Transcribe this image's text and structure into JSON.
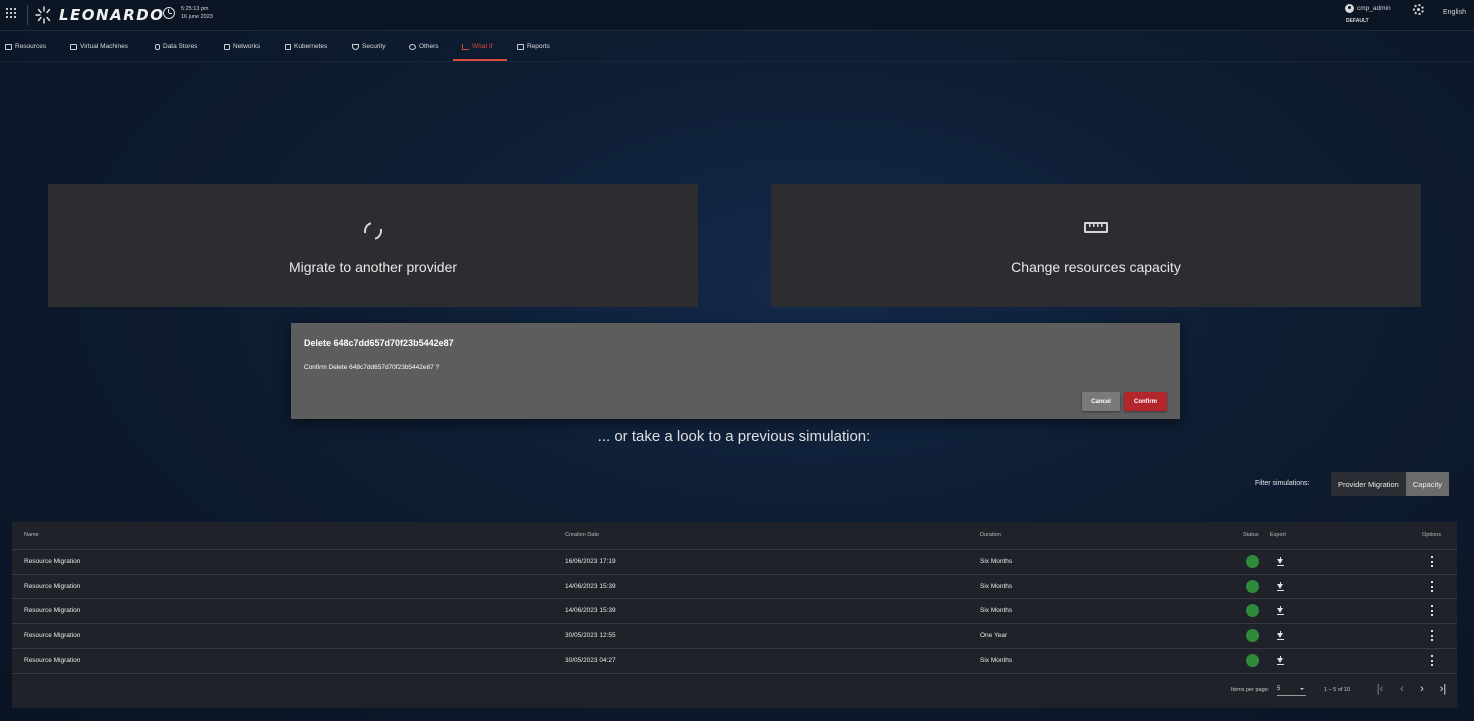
{
  "header": {
    "logo_text": "LEONARDO",
    "time": "5:25:13 pm",
    "date": "16 june 2023",
    "username": "cmp_admin",
    "tenant": "DEFAULT",
    "language": "English"
  },
  "nav": {
    "items": [
      {
        "label": "Resources",
        "icon": "resources-icon"
      },
      {
        "label": "Virtual Machines",
        "icon": "monitor-icon"
      },
      {
        "label": "Data Stores",
        "icon": "database-icon"
      },
      {
        "label": "Networks",
        "icon": "network-icon"
      },
      {
        "label": "Kubernetes",
        "icon": "kubernetes-icon"
      },
      {
        "label": "Security",
        "icon": "shield-icon"
      },
      {
        "label": "Others",
        "icon": "globe-icon"
      },
      {
        "label": "What If",
        "icon": "chart-line-icon",
        "active": true
      },
      {
        "label": "Reports",
        "icon": "report-icon"
      }
    ],
    "active_color": "#d94b3a"
  },
  "cards": [
    {
      "title": "Migrate to another provider",
      "icon": "refresh-icon"
    },
    {
      "title": "Change resources capacity",
      "icon": "ruler-icon"
    }
  ],
  "dialog": {
    "title": "Delete 648c7dd657d70f23b5442e87",
    "message": "Confirm Delete 648c7dd657d70f23b5442e87 ?",
    "cancel_label": "Cancel",
    "confirm_label": "Confirm",
    "confirm_color": "#b3262b"
  },
  "previous": {
    "title": "... or take a look to a previous simulation:"
  },
  "filter": {
    "label": "Filter simulations:",
    "options": [
      "Provider Migration",
      "Capacity"
    ],
    "selected": "Capacity"
  },
  "table": {
    "columns": {
      "name": "Name",
      "creation_date": "Creation Date",
      "duration": "Duration",
      "status": "Status",
      "export": "Export",
      "options": "Options"
    },
    "rows": [
      {
        "name": "Resource Migration",
        "creation_date": "16/06/2023 17:19",
        "duration": "Six Months",
        "status": "ok"
      },
      {
        "name": "Resource Migration",
        "creation_date": "14/06/2023 15:39",
        "duration": "Six Months",
        "status": "ok"
      },
      {
        "name": "Resource Migration",
        "creation_date": "14/06/2023 15:39",
        "duration": "Six Months",
        "status": "ok"
      },
      {
        "name": "Resource Migration",
        "creation_date": "30/05/2023 12:55",
        "duration": "One Year",
        "status": "ok"
      },
      {
        "name": "Resource Migration",
        "creation_date": "30/05/2023 04:27",
        "duration": "Six Months",
        "status": "ok"
      }
    ],
    "status_color": "#2e8b3a",
    "paginator": {
      "items_per_page_label": "Items per page:",
      "items_per_page": "5",
      "range": "1 – 5 of 10"
    }
  }
}
